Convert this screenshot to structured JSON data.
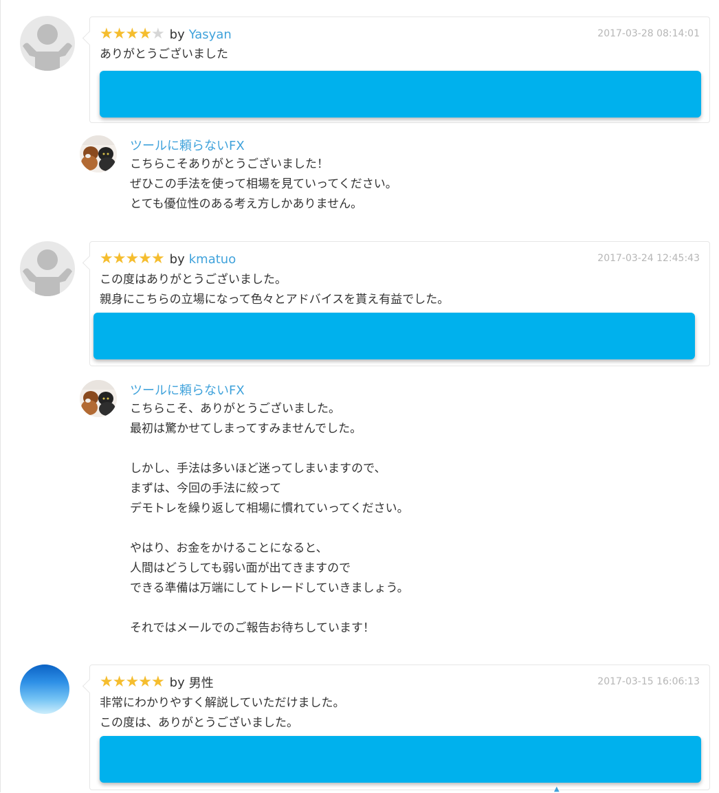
{
  "reviews": [
    {
      "rating": 4,
      "by": "by",
      "author": "Yasyan",
      "timestamp": "2017-03-28 08:14:01",
      "text": "ありがとうございました",
      "reply": {
        "author": "ツールに頼らないFX",
        "text": "こちらこそありがとうございました！\nぜひこの手法を使って相場を見ていってください。\nとても優位性のある考え方しかありません。"
      }
    },
    {
      "rating": 5,
      "by": "by",
      "author": "kmatuo",
      "timestamp": "2017-03-24 12:45:43",
      "text": "この度はありがとうございました。\n親身にこちらの立場になって色々とアドバイスを貰え有益でした。",
      "reply": {
        "author": "ツールに頼らないFX",
        "text": "こちらこそ、ありがとうございました。\n最初は驚かせてしまってすみませんでした。\n\nしかし、手法は多いほど迷ってしまいますので、\nまずは、今回の手法に絞って\nデモトレを繰り返して相場に慣れていってください。\n\nやはり、お金をかけることになると、\n人間はどうしても弱い面が出てきますので\nできる準備は万端にしてトレードしていきましょう。\n\nそれではメールでのご報告お待ちしています！"
      }
    },
    {
      "rating": 5,
      "by": "by",
      "author": "男性",
      "timestamp": "2017-03-15 16:06:13",
      "text": "非常にわかりやすく解説していただけました。\nこの度は、ありがとうございました。"
    }
  ],
  "colors": {
    "accent": "#3fa2db",
    "star": "#f5bd2e",
    "star_off": "#d6d6d6",
    "cta": "#00b1ed",
    "timestamp": "#b6b6b6"
  },
  "icons": {
    "default_avatar": "user-silhouette-icon",
    "star": "star-icon"
  }
}
